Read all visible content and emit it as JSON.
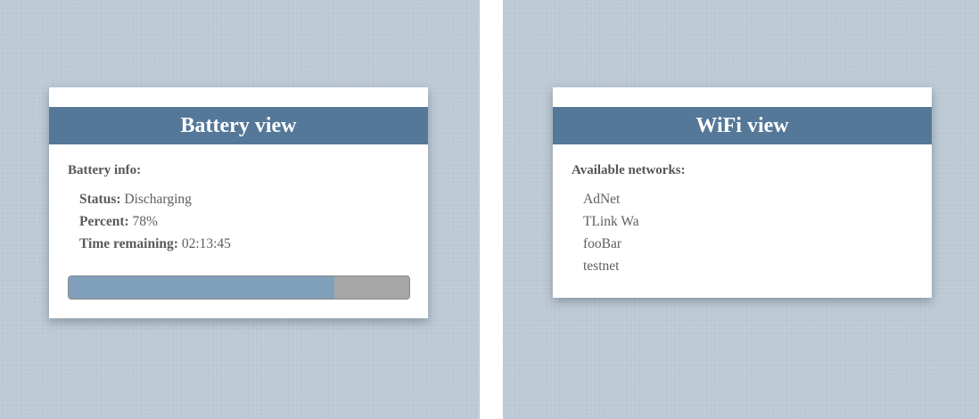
{
  "battery": {
    "title": "Battery view",
    "section_title": "Battery info:",
    "rows": [
      {
        "label": "Status:",
        "value": "Discharging"
      },
      {
        "label": "Percent:",
        "value": "78%"
      },
      {
        "label": "Time remaining:",
        "value": "02:13:45"
      }
    ],
    "level": 0.78
  },
  "wifi": {
    "title": "WiFi view",
    "section_title": "Available networks:",
    "networks": [
      "AdNet",
      "TLink Wa",
      "fooBar",
      "testnet"
    ]
  },
  "colors": {
    "header": "#557899",
    "background": "#bcc9d4",
    "bar_fill": "#809fbb",
    "bar_track": "#a6a6a6"
  }
}
